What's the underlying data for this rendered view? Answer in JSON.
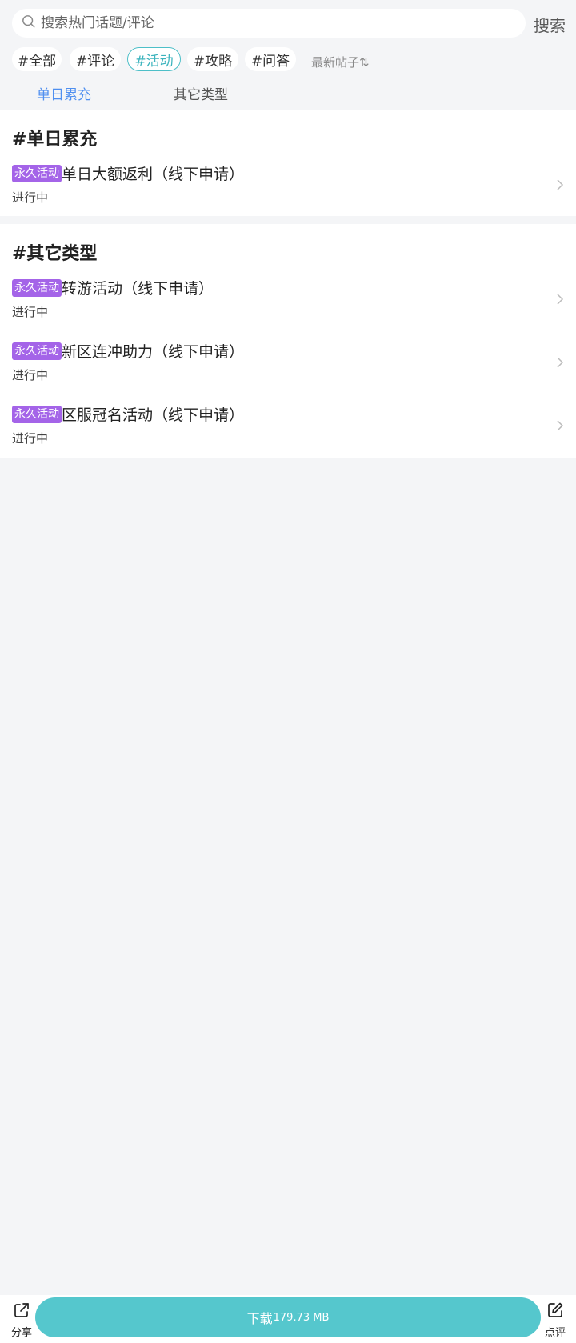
{
  "search": {
    "placeholder": "搜索热门话题/评论",
    "button_label": "搜索"
  },
  "filters": {
    "chips": [
      {
        "label": "#全部",
        "active": false
      },
      {
        "label": "#评论",
        "active": false
      },
      {
        "label": "#活动",
        "active": true
      },
      {
        "label": "#攻略",
        "active": false
      },
      {
        "label": "#问答",
        "active": false
      }
    ],
    "sort_label": "最新帖子⇅"
  },
  "subtabs": [
    {
      "label": "单日累充",
      "active": true
    },
    {
      "label": "其它类型",
      "active": false
    }
  ],
  "sections": [
    {
      "title": "#单日累充",
      "items": [
        {
          "tag": "永久活动",
          "title": "单日大额返利（线下申请）",
          "status": "进行中"
        }
      ]
    },
    {
      "title": "#其它类型",
      "items": [
        {
          "tag": "永久活动",
          "title": "转游活动（线下申请）",
          "status": "进行中"
        },
        {
          "tag": "永久活动",
          "title": "新区连冲助力（线下申请）",
          "status": "进行中"
        },
        {
          "tag": "永久活动",
          "title": "区服冠名活动（线下申请）",
          "status": "进行中"
        }
      ]
    }
  ],
  "bottom_bar": {
    "share_label": "分享",
    "download_label": "下载",
    "download_size": "179.73 MB",
    "review_label": "点评"
  },
  "colors": {
    "accent": "#55c7cd",
    "tag": "#a464e8",
    "tab_active": "#4f8ff0",
    "chip_active": "#3bb3bd"
  }
}
